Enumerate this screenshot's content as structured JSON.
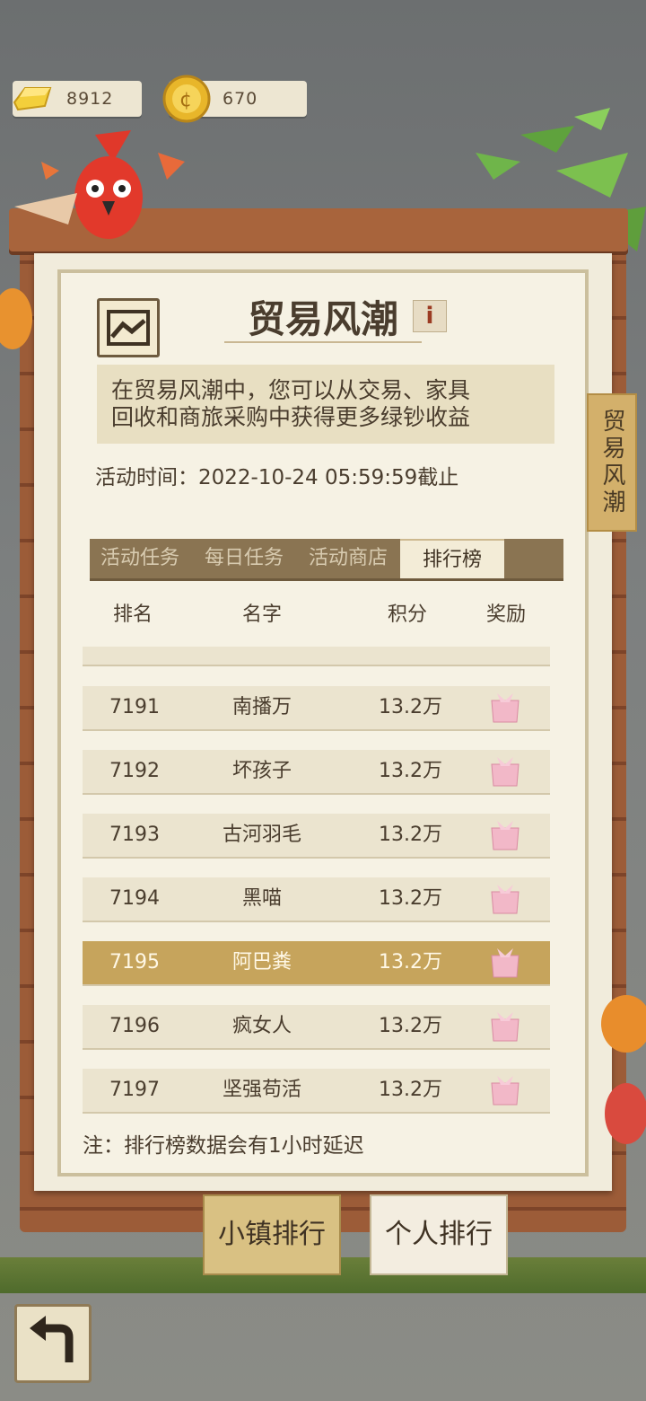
{
  "currency": {
    "gold_bar": "8912",
    "coin": "670"
  },
  "panel": {
    "title": "贸易风潮",
    "info_label": "i",
    "description_line1": "在贸易风潮中，您可以从交易、家具",
    "description_line2": "回收和商旅采购中获得更多绿钞收益",
    "time_text": "活动时间：2022-10-24 05:59:59截止",
    "side_tab": "贸易风潮"
  },
  "tabs": [
    "活动任务",
    "每日任务",
    "活动商店",
    "排行榜"
  ],
  "headers": {
    "rank": "排名",
    "name": "名字",
    "score": "积分",
    "reward": "奖励"
  },
  "rows": [
    {
      "rank": "7191",
      "name": "南播万",
      "score": "13.2万"
    },
    {
      "rank": "7192",
      "name": "坏孩子",
      "score": "13.2万"
    },
    {
      "rank": "7193",
      "name": "古河羽毛",
      "score": "13.2万"
    },
    {
      "rank": "7194",
      "name": "黑喵",
      "score": "13.2万"
    },
    {
      "rank": "7195",
      "name": "阿巴粪",
      "score": "13.2万"
    },
    {
      "rank": "7196",
      "name": "疯女人",
      "score": "13.2万"
    },
    {
      "rank": "7197",
      "name": "坚强苟活",
      "score": "13.2万"
    }
  ],
  "note": "注：排行榜数据会有1小时延迟",
  "buttons": {
    "town": "小镇排行",
    "personal": "个人排行"
  },
  "colors": {
    "highlight_row": "#c6a45c",
    "board": "#9c5c38",
    "paper": "#f1ecdc"
  }
}
